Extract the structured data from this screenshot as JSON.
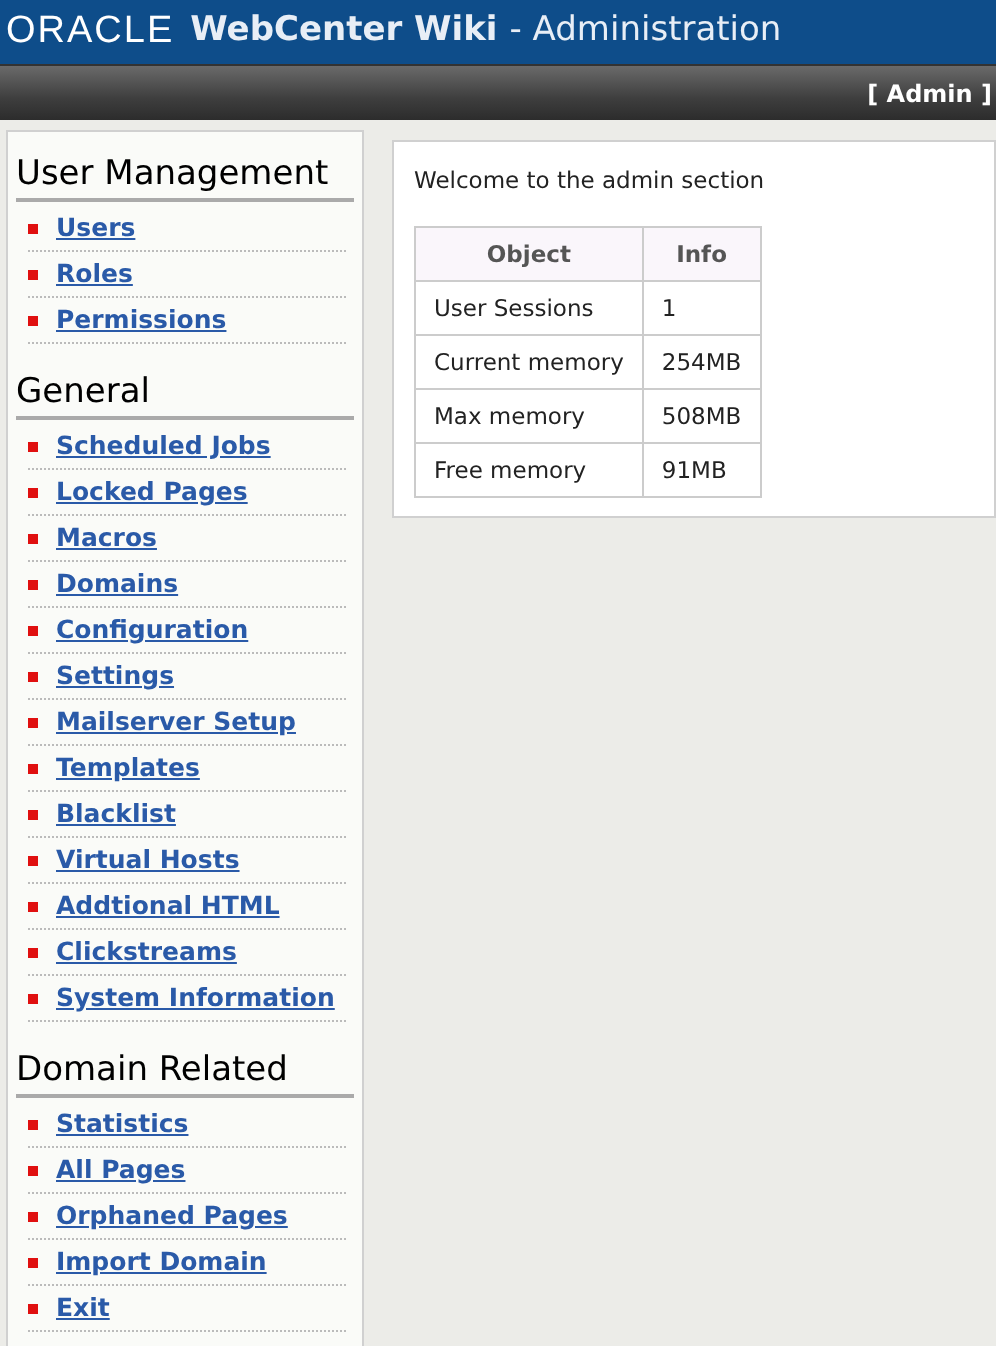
{
  "header": {
    "logo": "ORACLE",
    "title": "WebCenter Wiki",
    "subtitle": "- Administration"
  },
  "toolbar": {
    "user_link": "[ Admin ]"
  },
  "sidebar": {
    "sections": [
      {
        "heading": "User Management",
        "items": [
          "Users",
          "Roles",
          "Permissions"
        ]
      },
      {
        "heading": "General",
        "items": [
          "Scheduled Jobs",
          "Locked Pages",
          "Macros",
          "Domains",
          "Configuration",
          "Settings",
          "Mailserver Setup",
          "Templates",
          "Blacklist",
          "Virtual Hosts",
          "Addtional HTML",
          "Clickstreams",
          "System Information"
        ]
      },
      {
        "heading": "Domain Related",
        "items": [
          "Statistics",
          "All Pages",
          "Orphaned Pages",
          "Import Domain",
          "Exit"
        ]
      }
    ]
  },
  "main": {
    "welcome": "Welcome to the admin section",
    "table": {
      "columns": [
        "Object",
        "Info"
      ],
      "rows": [
        [
          "User Sessions",
          "1"
        ],
        [
          "Current memory",
          "254MB"
        ],
        [
          "Max memory",
          "508MB"
        ],
        [
          "Free memory",
          "91MB"
        ]
      ]
    }
  }
}
